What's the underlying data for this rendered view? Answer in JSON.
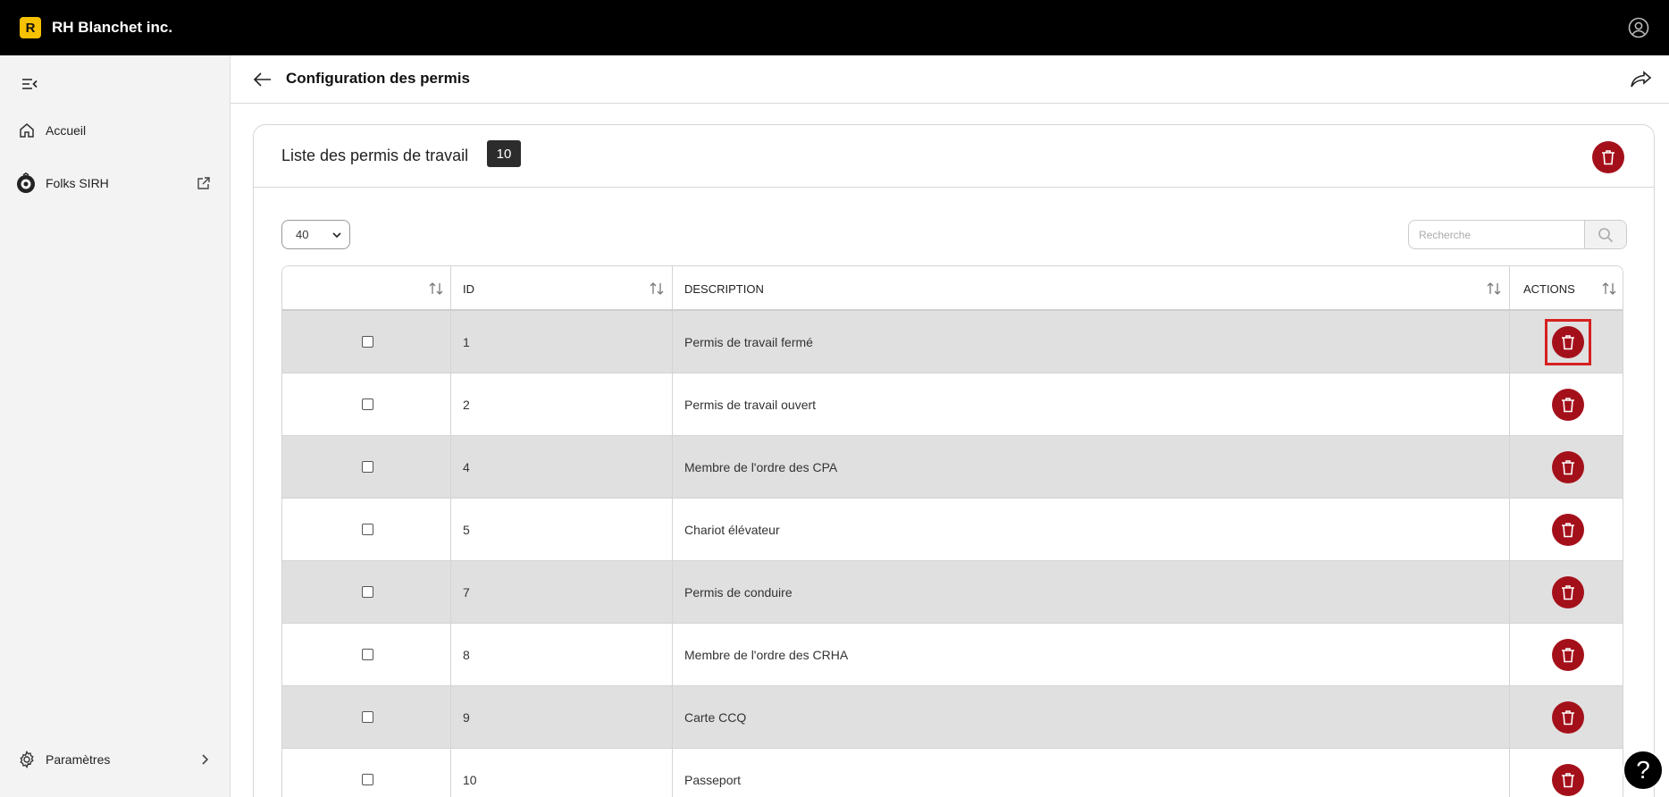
{
  "app": {
    "logo_letter": "R",
    "company": "RH Blanchet inc."
  },
  "sidebar": {
    "items": [
      {
        "label": "Accueil",
        "icon": "home-icon"
      },
      {
        "label": "Folks SIRH",
        "icon": "folks-logo-icon",
        "external": true
      }
    ],
    "settings_label": "Paramètres"
  },
  "header": {
    "title": "Configuration des permis"
  },
  "card": {
    "title": "Liste des permis de travail",
    "count": "10"
  },
  "controls": {
    "page_size": "40",
    "search_placeholder": "Recherche"
  },
  "table": {
    "columns": [
      "",
      "ID",
      "DESCRIPTION",
      "ACTIONS"
    ],
    "rows": [
      {
        "id": "1",
        "description": "Permis de travail fermé"
      },
      {
        "id": "2",
        "description": "Permis de travail ouvert"
      },
      {
        "id": "4",
        "description": "Membre de l'ordre des CPA"
      },
      {
        "id": "5",
        "description": "Chariot élévateur"
      },
      {
        "id": "7",
        "description": "Permis de conduire"
      },
      {
        "id": "8",
        "description": "Membre de l'ordre des CRHA"
      },
      {
        "id": "9",
        "description": "Carte CCQ"
      },
      {
        "id": "10",
        "description": "Passeport"
      }
    ]
  },
  "help": {
    "label": "?"
  },
  "colors": {
    "accent_red": "#a4101a",
    "logo_yellow": "#f6c100",
    "topbar": "#000000",
    "row_shaded": "#e0e0e0"
  }
}
